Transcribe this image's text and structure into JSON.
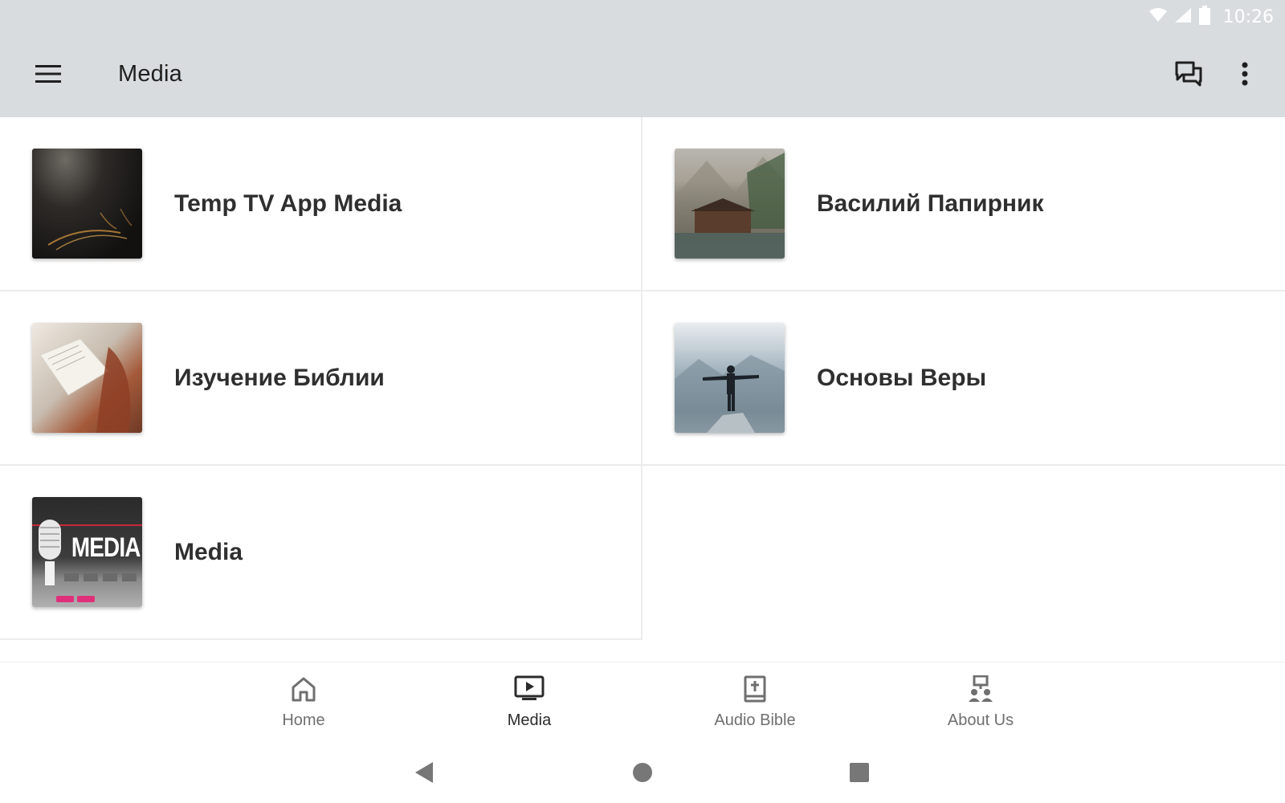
{
  "status_bar": {
    "time": "10:26",
    "icons": [
      "wifi-icon",
      "cell-signal-icon",
      "battery-icon"
    ]
  },
  "app_bar": {
    "title": "Media",
    "icons": [
      "hamburger-menu-icon",
      "chat-icon",
      "more-vert-icon"
    ]
  },
  "media_items": [
    {
      "label": "Temp TV App Media",
      "thumb": "dark-abstract"
    },
    {
      "label": "Василий Папирник",
      "thumb": "lake-cabin"
    },
    {
      "label": "Изучение Библии",
      "thumb": "reading-bible"
    },
    {
      "label": "Основы Веры",
      "thumb": "man-on-mountain"
    },
    {
      "label": "Media",
      "thumb": "media-microphone",
      "thumb_text": "MEDIA"
    }
  ],
  "bottom_nav": {
    "items": [
      {
        "label": "Home",
        "icon": "home-icon",
        "active": false
      },
      {
        "label": "Media",
        "icon": "tv-play-icon",
        "active": true
      },
      {
        "label": "Audio Bible",
        "icon": "bible-icon",
        "active": false
      },
      {
        "label": "About Us",
        "icon": "people-icon",
        "active": false
      }
    ]
  },
  "system_nav": [
    "back-icon",
    "home-circle-icon",
    "recents-icon"
  ],
  "colors": {
    "app_bar_bg": "#d9dcde",
    "text_primary": "#2f2f2f",
    "nav_inactive": "#6f6f6f"
  }
}
